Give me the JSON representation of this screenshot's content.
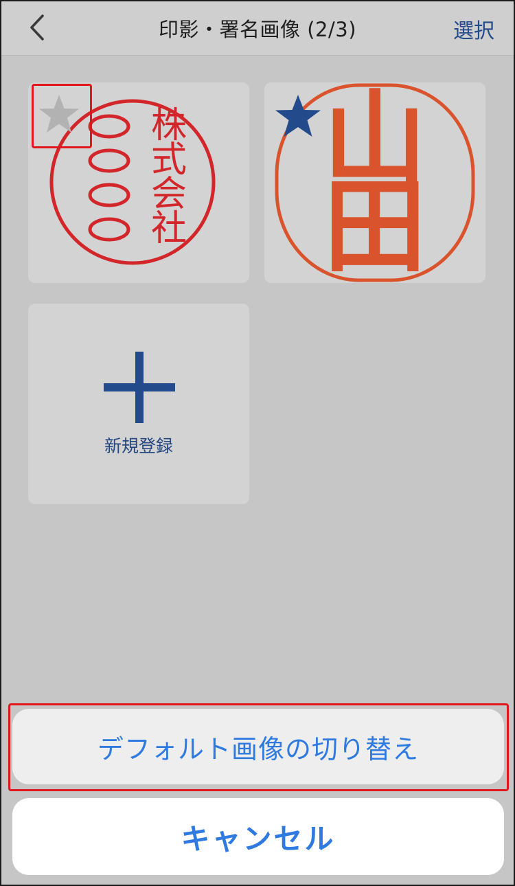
{
  "navbar": {
    "back_icon": "chevron-left-icon",
    "title": "印影・署名画像 (2/3)",
    "select_label": "選択"
  },
  "tiles": [
    {
      "seal_chars_right": [
        "株",
        "式",
        "会",
        "社"
      ],
      "seal_chars_left": [
        "〇",
        "〇",
        "〇",
        "〇"
      ],
      "seal_color": "#d2262a",
      "star_icon": "star-icon",
      "star_color": "#b2b2b2",
      "is_default": false
    },
    {
      "seal_chars": [
        "山",
        "田"
      ],
      "seal_color": "#d9532c",
      "star_icon": "star-icon",
      "star_color": "#234a8a",
      "is_default": true
    }
  ],
  "add_tile": {
    "icon": "plus-icon",
    "label": "新規登録"
  },
  "action_sheet": {
    "switch_default_label": "デフォルト画像の切り替え",
    "cancel_label": "キャンセル"
  },
  "colors": {
    "accent": "#2f7ae0",
    "nav_blue": "#234a8a",
    "highlight_red": "#e0171c"
  }
}
